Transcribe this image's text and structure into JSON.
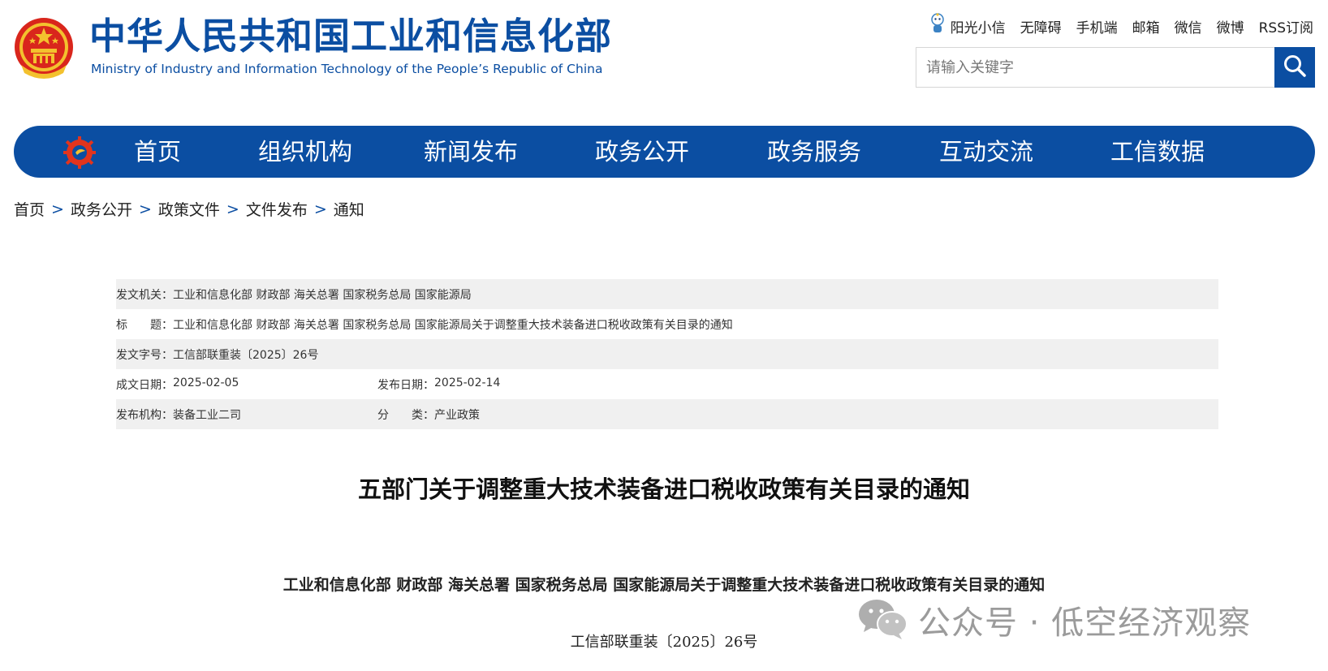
{
  "header": {
    "title": "中华人民共和国工业和信息化部",
    "subtitle": "Ministry of Industry and Information Technology of the People’s Republic of China",
    "top_links": [
      "阳光小信",
      "无障碍",
      "手机端",
      "邮箱",
      "微信",
      "微博",
      "RSS订阅"
    ],
    "search_placeholder": "请输入关键字"
  },
  "nav": {
    "items": [
      "首页",
      "组织机构",
      "新闻发布",
      "政务公开",
      "政务服务",
      "互动交流",
      "工信数据"
    ]
  },
  "breadcrumb": [
    "首页",
    "政务公开",
    "政策文件",
    "文件发布",
    "通知"
  ],
  "breadcrumb_sep": ">",
  "meta": {
    "issuer_label": "发文机关：",
    "issuer": "工业和信息化部 财政部 海关总署 国家税务总局 国家能源局",
    "title_label": "标　　题：",
    "title": "工业和信息化部 财政部 海关总署 国家税务总局 国家能源局关于调整重大技术装备进口税收政策有关目录的通知",
    "docno_label": "发文字号：",
    "docno": "工信部联重装〔2025〕26号",
    "created_label": "成文日期：",
    "created": "2025-02-05",
    "published_label": "发布日期：",
    "published": "2025-02-14",
    "org_label": "发布机构：",
    "org": "装备工业二司",
    "category_label": "分　　类：",
    "category": "产业政策"
  },
  "article": {
    "title": "五部门关于调整重大技术装备进口税收政策有关目录的通知",
    "heading": "工业和信息化部  财政部  海关总署  国家税务总局  国家能源局关于调整重大技术装备进口税收政策有关目录的通知",
    "number": "工信部联重装〔2025〕26号"
  },
  "watermark": {
    "text": "公众号 · 低空经济观察"
  },
  "colors": {
    "brand_blue": "#0b4ea2",
    "meta_shade": "#f0f0f0"
  },
  "icons": [
    "national-emblem-icon",
    "sunshine-mascot-icon",
    "search-icon",
    "nav-gear-logo-icon",
    "wechat-icon"
  ]
}
